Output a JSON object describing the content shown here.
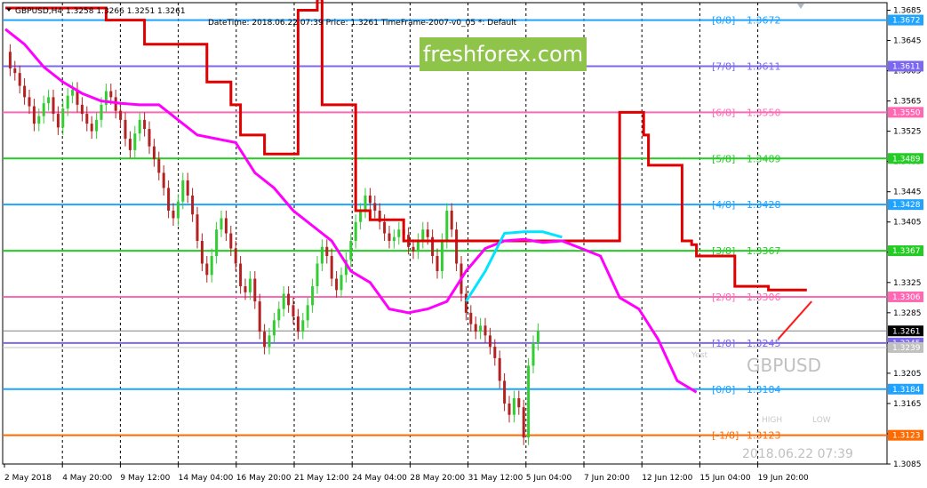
{
  "header": {
    "symbol": "GBPUSD,H4",
    "ohlc": "1.3258 1.3266 1.3251 1.3261",
    "indicator_info": "DateTime: 2018.06.22 07:39    Price: 1.3261    TimeFrame-2007-v0_05    *: Default"
  },
  "watermark_text": "freshforex.com",
  "overlay": {
    "symbol": "GBPUSD",
    "datetime": "2018.06.22 07:39",
    "high_label": "HIGH",
    "low_label": "LOW",
    "yesterday_label": "Yest"
  },
  "colors": {
    "bull": "#32cd32",
    "bear": "#b22222",
    "trend_red": "#e00000",
    "trend_magenta": "#ff00ff",
    "trend_cyan": "#00e5ff",
    "projection": "#ff1a1a"
  },
  "chart_data": {
    "type": "line",
    "instrument": "GBPUSD",
    "timeframe": "H4",
    "ylim": [
      1.3085,
      1.3695
    ],
    "y_ticks": [
      "1.3685",
      "1.3645",
      "1.3605",
      "1.3565",
      "1.3525",
      "1.3485",
      "1.3445",
      "1.3405",
      "1.3365",
      "1.3325",
      "1.3285",
      "1.3245",
      "1.3205",
      "1.3165",
      "1.3125",
      "1.3085"
    ],
    "x_ticks": [
      "2 May 2018",
      "4 May 20:00",
      "9 May 12:00",
      "14 May 04:00",
      "16 May 20:00",
      "21 May 12:00",
      "24 May 04:00",
      "28 May 20:00",
      "31 May 12:00",
      "5 Jun 04:00",
      "7 Jun 20:00",
      "12 Jun 12:00",
      "15 Jun 04:00",
      "19 Jun 20:00"
    ],
    "murrey_levels": [
      {
        "name": "[8/8]",
        "value": 1.3672,
        "color": "#1fa3ff",
        "price_label": "1.3672"
      },
      {
        "name": "[7/8]",
        "value": 1.3611,
        "color": "#7b68ee",
        "price_label": "1.3611"
      },
      {
        "name": "[6/8]",
        "value": 1.355,
        "color": "#ff69b4",
        "price_label": "1.3550"
      },
      {
        "name": "[5/8]",
        "value": 1.3489,
        "color": "#22cc22",
        "price_label": "1.3489"
      },
      {
        "name": "[4/8]",
        "value": 1.3428,
        "color": "#1fa3ff",
        "price_label": "1.3428"
      },
      {
        "name": "[3/8]",
        "value": 1.3367,
        "color": "#22cc22",
        "price_label": "1.3367"
      },
      {
        "name": "[2/8]",
        "value": 1.3306,
        "color": "#ff69b4",
        "price_label": "1.3306"
      },
      {
        "name": "[1/8]",
        "value": 1.3245,
        "color": "#7b68ee",
        "price_label": "1.3245"
      },
      {
        "name": "[0/8]",
        "value": 1.3184,
        "color": "#1fa3ff",
        "price_label": "1.3184"
      },
      {
        "name": "[-1/8]",
        "value": 1.3123,
        "color": "#ff6a00",
        "price_label": "1.3123"
      }
    ],
    "current_price": {
      "value": 1.3261,
      "label": "1.3261"
    },
    "extra_price_label": {
      "value": 1.3239,
      "label": "1.3239"
    },
    "close_series": [
      1.363,
      1.3608,
      1.3602,
      1.3585,
      1.357,
      1.3558,
      1.3535,
      1.3545,
      1.3562,
      1.357,
      1.3548,
      1.353,
      1.3555,
      1.3572,
      1.358,
      1.356,
      1.3548,
      1.3535,
      1.3525,
      1.354,
      1.356,
      1.3578,
      1.357,
      1.3552,
      1.354,
      1.3515,
      1.35,
      1.3522,
      1.354,
      1.3528,
      1.3505,
      1.3488,
      1.347,
      1.345,
      1.342,
      1.341,
      1.3432,
      1.346,
      1.344,
      1.3415,
      1.338,
      1.335,
      1.3335,
      1.336,
      1.3395,
      1.341,
      1.339,
      1.337,
      1.335,
      1.332,
      1.3312,
      1.333,
      1.33,
      1.326,
      1.324,
      1.3255,
      1.3275,
      1.329,
      1.331,
      1.3295,
      1.328,
      1.326,
      1.3275,
      1.3295,
      1.332,
      1.335,
      1.3372,
      1.336,
      1.333,
      1.3315,
      1.3335,
      1.3355,
      1.338,
      1.3405,
      1.342,
      1.344,
      1.343,
      1.342,
      1.3405,
      1.339,
      1.338,
      1.3385,
      1.3395,
      1.3388,
      1.3372,
      1.3366,
      1.338,
      1.3395,
      1.3385,
      1.336,
      1.334,
      1.338,
      1.342,
      1.3395,
      1.335,
      1.331,
      1.3285,
      1.327,
      1.326,
      1.3268,
      1.3255,
      1.324,
      1.3225,
      1.3195,
      1.3165,
      1.315,
      1.3172,
      1.316,
      1.312,
      1.3215,
      1.3245,
      1.3261
    ],
    "series": [
      {
        "name": "red step",
        "x": [
          0,
          21,
          21,
          29,
          29,
          42,
          42,
          47,
          47,
          49,
          49,
          54,
          54,
          61,
          61,
          65,
          65,
          66,
          66,
          73,
          73,
          76,
          76,
          83,
          83,
          128,
          128,
          133,
          133,
          134,
          134,
          141,
          141,
          143,
          143,
          144,
          144,
          152,
          152,
          159,
          159,
          167
        ],
        "y": [
          1.3688,
          1.3688,
          1.3672,
          1.3672,
          1.364,
          1.364,
          1.359,
          1.359,
          1.356,
          1.356,
          1.352,
          1.352,
          1.3495,
          1.3495,
          1.3685,
          1.3685,
          1.37,
          1.37,
          1.356,
          1.356,
          1.342,
          1.342,
          1.3408,
          1.3408,
          1.338,
          1.338,
          1.355,
          1.355,
          1.352,
          1.352,
          1.348,
          1.348,
          1.338,
          1.338,
          1.3375,
          1.3375,
          1.336,
          1.336,
          1.332,
          1.332,
          1.3315,
          1.3315
        ]
      },
      {
        "name": "magenta",
        "x": [
          0,
          4,
          8,
          12,
          16,
          20,
          24,
          28,
          32,
          36,
          40,
          44,
          48,
          52,
          56,
          60,
          64,
          68,
          72,
          76,
          80,
          84,
          88,
          92,
          96,
          100,
          104,
          108,
          112,
          116,
          120,
          124,
          128,
          132,
          136,
          140,
          144
        ],
        "y": [
          1.366,
          1.364,
          1.361,
          1.359,
          1.3575,
          1.3565,
          1.3562,
          1.356,
          1.356,
          1.354,
          1.352,
          1.3515,
          1.351,
          1.347,
          1.345,
          1.342,
          1.34,
          1.338,
          1.334,
          1.3325,
          1.329,
          1.3285,
          1.329,
          1.33,
          1.334,
          1.337,
          1.338,
          1.3382,
          1.3378,
          1.338,
          1.337,
          1.336,
          1.3305,
          1.329,
          1.325,
          1.3195,
          1.318
        ]
      },
      {
        "name": "cyan",
        "x": [
          96,
          100,
          104,
          108,
          112,
          116
        ],
        "y": [
          1.33,
          1.334,
          1.339,
          1.3392,
          1.3392,
          1.3385
        ]
      },
      {
        "name": "projection",
        "x": [
          161,
          168
        ],
        "y": [
          1.325,
          1.33
        ]
      }
    ]
  }
}
